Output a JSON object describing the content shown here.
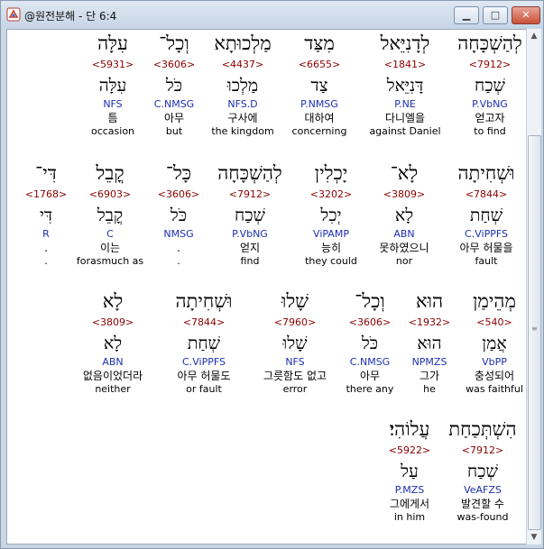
{
  "window": {
    "title": "@원전분해 - 단 6:4",
    "buttons": {
      "minimize": "▁",
      "maximize": "□",
      "close": "✕"
    }
  },
  "rows": [
    [
      {
        "hebrew": "לְהַשְׁכָּחָה",
        "strong": "<7912>",
        "lemma": "שְׁכַח",
        "morph": "P.VbNG",
        "korean": "얻고자",
        "english": "to find"
      },
      {
        "hebrew": "לְדָנִיֵּאל",
        "strong": "<1841>",
        "lemma": "דָּנִיֵּאל",
        "morph": "P.NE",
        "korean": "다니엘을",
        "english": "against Daniel"
      },
      {
        "hebrew": "מִצַּד",
        "strong": "<6655>",
        "lemma": "צַד",
        "morph": "P.NMSG",
        "korean": "대하여",
        "english": "concerning"
      },
      {
        "hebrew": "מַלְכוּתָא",
        "strong": "<4437>",
        "lemma": "מַלְכוּ",
        "morph": "NFS.D",
        "korean": "구사에",
        "english": "the kingdom"
      },
      {
        "hebrew": "וְכָל־",
        "strong": "<3606>",
        "lemma": "כֹּל",
        "morph": "C.NMSG",
        "korean": "아무",
        "english": "but"
      },
      {
        "hebrew": "עִלָּה",
        "strong": "<5931>",
        "lemma": "עִלָּה",
        "morph": "NFS",
        "korean": "틈",
        "english": "occasion"
      }
    ],
    [
      {
        "hebrew": "וּשְׁחִיתָה",
        "strong": "<7844>",
        "lemma": "שְׁחַת",
        "morph": "C.ViPPFS",
        "korean": "아무 허물을",
        "english": "fault"
      },
      {
        "hebrew": "לָא־",
        "strong": "<3809>",
        "lemma": "לָא",
        "morph": "ABN",
        "korean": "못하였으니",
        "english": "nor"
      },
      {
        "hebrew": "יָכְלִין",
        "strong": "<3202>",
        "lemma": "יְכִל",
        "morph": "ViPAMP",
        "korean": "능히",
        "english": "they could"
      },
      {
        "hebrew": "לְהַשְׁכָּחָה",
        "strong": "<7912>",
        "lemma": "שְׁכַח",
        "morph": "P.VbNG",
        "korean": "얻지",
        "english": "find"
      },
      {
        "hebrew": "כָּל־",
        "strong": "<3606>",
        "lemma": "כֹּל",
        "morph": "NMSG",
        "korean": ".",
        "english": "."
      },
      {
        "hebrew": "קֳבֵל",
        "strong": "<6903>",
        "lemma": "קֳבֵל",
        "morph": "C",
        "korean": "이는",
        "english": "forasmuch as"
      },
      {
        "hebrew": "דִּי־",
        "strong": "<1768>",
        "lemma": "דִּי",
        "morph": "R",
        "korean": ".",
        "english": "."
      }
    ],
    [
      {
        "hebrew": "מְהֵימַן",
        "strong": "<540>",
        "lemma": "אֲמַן",
        "morph": "VbPP",
        "korean": "충성되어",
        "english": "was faithful"
      },
      {
        "hebrew": "הוּא",
        "strong": "<1932>",
        "lemma": "הוּא",
        "morph": "NPMZS",
        "korean": "그가",
        "english": "he"
      },
      {
        "hebrew": "וְכָל־",
        "strong": "<3606>",
        "lemma": "כֹּל",
        "morph": "C.NMSG",
        "korean": "아무",
        "english": "there any"
      },
      {
        "hebrew": "שָׁלוּ",
        "strong": "<7960>",
        "lemma": "שָׁלוּ",
        "morph": "NFS",
        "korean": "그릇함도 없고",
        "english": "error"
      },
      {
        "hebrew": "וּשְׁחִיתָה",
        "strong": "<7844>",
        "lemma": "שְׁחַת",
        "morph": "C.ViPPFS",
        "korean": "아무 허물도",
        "english": "or fault"
      },
      {
        "hebrew": "לָא",
        "strong": "<3809>",
        "lemma": "לָא",
        "morph": "ABN",
        "korean": "없음이었더라",
        "english": "neither"
      }
    ],
    [
      {
        "hebrew": "הִשְׁתְּכַחַת",
        "strong": "<7912>",
        "lemma": "שְׁכַח",
        "morph": "VeAFZS",
        "korean": "발견할 수",
        "english": "was-found"
      },
      {
        "hebrew": "עֲלוֹהִי׃",
        "strong": "<5922>",
        "lemma": "עַל",
        "morph": "P.MZS",
        "korean": "그에게서",
        "english": "in him"
      }
    ]
  ]
}
